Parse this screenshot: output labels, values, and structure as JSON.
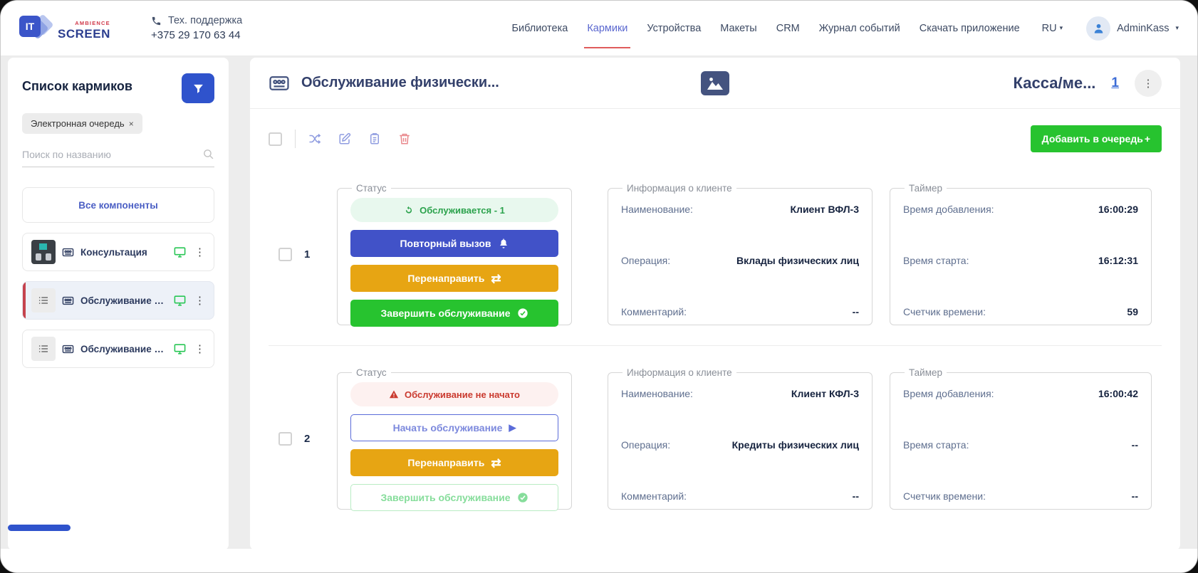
{
  "header": {
    "logo": {
      "it": "IT",
      "screen": "SCREEN",
      "ambience": "AMBIENCE"
    },
    "support": {
      "label": "Тех. поддержка",
      "phone": "+375 29 170 63 44"
    },
    "nav": [
      {
        "label": "Библиотека"
      },
      {
        "label": "Кармики"
      },
      {
        "label": "Устройства"
      },
      {
        "label": "Макеты"
      },
      {
        "label": "CRM"
      },
      {
        "label": "Журнал событий"
      },
      {
        "label": "Скачать приложение"
      }
    ],
    "lang": "RU",
    "user": "AdminKass"
  },
  "sidebar": {
    "title": "Список кармиков",
    "filter_chip": "Электронная очередь",
    "chip_close": "×",
    "search_placeholder": "Поиск по названию",
    "all_components": "Все компоненты",
    "items": [
      {
        "label": "Консультация"
      },
      {
        "label": "Обслуживание физических л..."
      },
      {
        "label": "Обслуживание юридических ..."
      }
    ]
  },
  "main": {
    "title": "Обслуживание физически...",
    "cashdesk": "Касса/ме...",
    "cashdesk_count": "1",
    "add_button": "Добавить в очередь",
    "add_plus": "+",
    "rows": [
      {
        "number": "1",
        "status_legend": "Статус",
        "status": "Обслуживается - 1",
        "actions": {
          "primary": "Повторный вызов",
          "redirect": "Перенаправить",
          "finish": "Завершить обслуживание"
        },
        "client": {
          "legend": "Информация о клиенте",
          "name_label": "Наименование:",
          "name": "Клиент ВФЛ-3",
          "op_label": "Операция:",
          "op": "Вклады физических лиц",
          "comment_label": "Комментарий:",
          "comment": "--"
        },
        "timer": {
          "legend": "Таймер",
          "added_label": "Время добавления:",
          "added": "16:00:29",
          "start_label": "Время старта:",
          "start": "16:12:31",
          "counter_label": "Счетчик времени:",
          "counter": "59"
        }
      },
      {
        "number": "2",
        "status_legend": "Статус",
        "status": "Обслуживание не начато",
        "actions": {
          "primary": "Начать обслуживание",
          "redirect": "Перенаправить",
          "finish": "Завершить обслуживание"
        },
        "client": {
          "legend": "Информация о клиенте",
          "name_label": "Наименование:",
          "name": "Клиент КФЛ-3",
          "op_label": "Операция:",
          "op": "Кредиты физических лиц",
          "comment_label": "Комментарий:",
          "comment": "--"
        },
        "timer": {
          "legend": "Таймер",
          "added_label": "Время добавления:",
          "added": "16:00:42",
          "start_label": "Время старта:",
          "start": "--",
          "counter_label": "Счетчик времени:",
          "counter": "--"
        }
      }
    ]
  },
  "icons": {
    "swap_glyph": "⇄",
    "play_glyph": "▶",
    "dots_glyph": "⋮",
    "caret_glyph": "▾"
  }
}
